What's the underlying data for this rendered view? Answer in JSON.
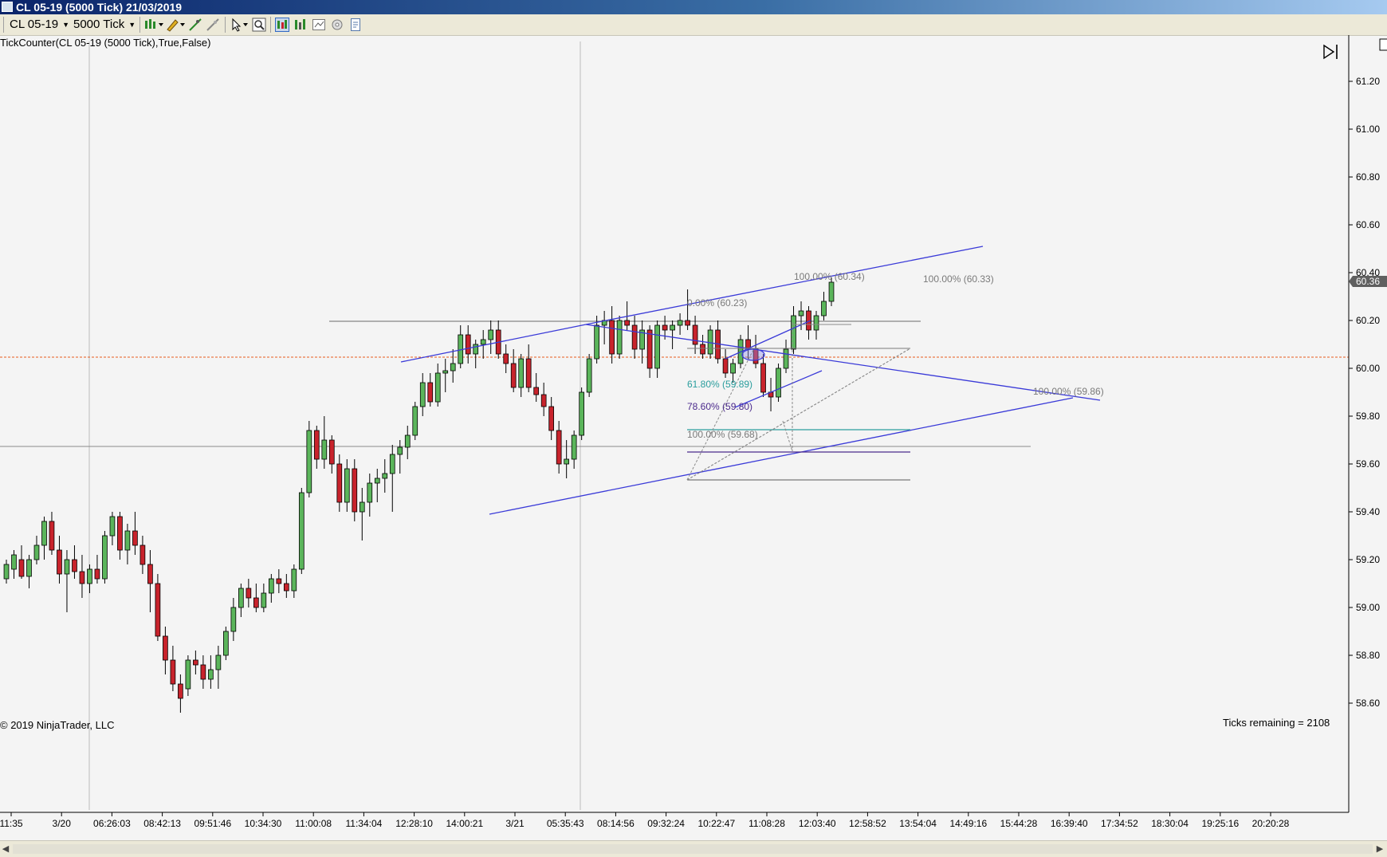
{
  "window": {
    "title": "CL 05-19 (5000 Tick)  21/03/2019"
  },
  "toolbar": {
    "instrument": "CL 05-19",
    "period": "5000 Tick"
  },
  "indicator_label": "TickCounter(CL 05-19 (5000 Tick),True,False)",
  "copyright": "© 2019 NinjaTrader, LLC",
  "ticks_remaining": "Ticks remaining = 2108",
  "price_axis": {
    "labels": [
      "61.20",
      "61.00",
      "60.80",
      "60.60",
      "60.40",
      "60.20",
      "60.00",
      "59.80",
      "59.60",
      "59.40",
      "59.20",
      "59.00",
      "58.80",
      "58.60"
    ],
    "last_price": "60.36"
  },
  "time_axis": {
    "labels": [
      "11:35",
      "3/20",
      "06:26:03",
      "08:42:13",
      "09:51:46",
      "10:34:30",
      "11:00:08",
      "11:34:04",
      "12:28:10",
      "14:00:21",
      "3/21",
      "05:35:43",
      "08:14:56",
      "09:32:24",
      "10:22:47",
      "11:08:28",
      "12:03:40",
      "12:58:52",
      "13:54:04",
      "14:49:16",
      "15:44:28",
      "16:39:40",
      "17:34:52",
      "18:30:04",
      "19:25:16",
      "20:20:28"
    ]
  },
  "fib_labels": {
    "a": "100.00% (60.34)",
    "b": "100.00% (60.33)",
    "c": "0.00% (60.23)",
    "d": "61.80% (59.89)",
    "e": "78.60% (59.80)",
    "f": "100.00% (59.68)",
    "g": "100.00% (59.86)"
  },
  "colors": {
    "up_candle": "#5bb55b",
    "down_candle": "#c8232c",
    "trendline": "#3a3ad8",
    "fib_618": "#2a9d9d",
    "fib_786": "#4b2a8c",
    "current_price_line": "#e85c1c",
    "last_price_bg": "#606060"
  },
  "chart_data": {
    "type": "candlestick",
    "instrument": "CL 05-19",
    "ylim": [
      58.55,
      61.34
    ],
    "y_ticks": [
      61.2,
      61.0,
      60.8,
      60.6,
      60.4,
      60.2,
      60.0,
      59.8,
      59.6,
      59.4,
      59.2,
      59.0,
      58.8,
      58.6
    ],
    "last_price": 60.36,
    "current_price_line": 60.19,
    "candles": [
      {
        "o": 59.12,
        "h": 59.2,
        "l": 59.1,
        "c": 59.18
      },
      {
        "o": 59.16,
        "h": 59.24,
        "l": 59.12,
        "c": 59.22
      },
      {
        "o": 59.2,
        "h": 59.26,
        "l": 59.12,
        "c": 59.13
      },
      {
        "o": 59.13,
        "h": 59.22,
        "l": 59.08,
        "c": 59.2
      },
      {
        "o": 59.2,
        "h": 59.3,
        "l": 59.18,
        "c": 59.26
      },
      {
        "o": 59.26,
        "h": 59.38,
        "l": 59.2,
        "c": 59.36
      },
      {
        "o": 59.36,
        "h": 59.4,
        "l": 59.22,
        "c": 59.24
      },
      {
        "o": 59.24,
        "h": 59.3,
        "l": 59.1,
        "c": 59.14
      },
      {
        "o": 59.14,
        "h": 59.24,
        "l": 58.98,
        "c": 59.2
      },
      {
        "o": 59.2,
        "h": 59.26,
        "l": 59.12,
        "c": 59.15
      },
      {
        "o": 59.15,
        "h": 59.22,
        "l": 59.04,
        "c": 59.1
      },
      {
        "o": 59.1,
        "h": 59.18,
        "l": 59.06,
        "c": 59.16
      },
      {
        "o": 59.16,
        "h": 59.22,
        "l": 59.1,
        "c": 59.12
      },
      {
        "o": 59.12,
        "h": 59.32,
        "l": 59.1,
        "c": 59.3
      },
      {
        "o": 59.3,
        "h": 59.4,
        "l": 59.26,
        "c": 59.38
      },
      {
        "o": 59.38,
        "h": 59.4,
        "l": 59.2,
        "c": 59.24
      },
      {
        "o": 59.24,
        "h": 59.35,
        "l": 59.18,
        "c": 59.32
      },
      {
        "o": 59.32,
        "h": 59.4,
        "l": 59.22,
        "c": 59.26
      },
      {
        "o": 59.26,
        "h": 59.3,
        "l": 59.14,
        "c": 59.18
      },
      {
        "o": 59.18,
        "h": 59.24,
        "l": 58.98,
        "c": 59.1
      },
      {
        "o": 59.1,
        "h": 59.14,
        "l": 58.86,
        "c": 58.88
      },
      {
        "o": 58.88,
        "h": 58.92,
        "l": 58.72,
        "c": 58.78
      },
      {
        "o": 58.78,
        "h": 58.84,
        "l": 58.65,
        "c": 58.68
      },
      {
        "o": 58.68,
        "h": 58.72,
        "l": 58.56,
        "c": 58.62
      },
      {
        "o": 58.66,
        "h": 58.8,
        "l": 58.63,
        "c": 58.78
      },
      {
        "o": 58.78,
        "h": 58.82,
        "l": 58.72,
        "c": 58.76
      },
      {
        "o": 58.76,
        "h": 58.8,
        "l": 58.66,
        "c": 58.7
      },
      {
        "o": 58.7,
        "h": 58.8,
        "l": 58.66,
        "c": 58.74
      },
      {
        "o": 58.74,
        "h": 58.84,
        "l": 58.66,
        "c": 58.8
      },
      {
        "o": 58.8,
        "h": 58.92,
        "l": 58.78,
        "c": 58.9
      },
      {
        "o": 58.9,
        "h": 59.04,
        "l": 58.86,
        "c": 59.0
      },
      {
        "o": 59.0,
        "h": 59.1,
        "l": 58.96,
        "c": 59.08
      },
      {
        "o": 59.08,
        "h": 59.12,
        "l": 59.0,
        "c": 59.04
      },
      {
        "o": 59.04,
        "h": 59.1,
        "l": 58.98,
        "c": 59.0
      },
      {
        "o": 59.0,
        "h": 59.1,
        "l": 58.98,
        "c": 59.06
      },
      {
        "o": 59.06,
        "h": 59.14,
        "l": 59.02,
        "c": 59.12
      },
      {
        "o": 59.12,
        "h": 59.16,
        "l": 59.06,
        "c": 59.1
      },
      {
        "o": 59.1,
        "h": 59.14,
        "l": 59.04,
        "c": 59.07
      },
      {
        "o": 59.07,
        "h": 59.18,
        "l": 59.04,
        "c": 59.16
      },
      {
        "o": 59.16,
        "h": 59.5,
        "l": 59.14,
        "c": 59.48
      },
      {
        "o": 59.48,
        "h": 59.78,
        "l": 59.46,
        "c": 59.74
      },
      {
        "o": 59.74,
        "h": 59.76,
        "l": 59.58,
        "c": 59.62
      },
      {
        "o": 59.62,
        "h": 59.8,
        "l": 59.58,
        "c": 59.7
      },
      {
        "o": 59.7,
        "h": 59.72,
        "l": 59.56,
        "c": 59.6
      },
      {
        "o": 59.6,
        "h": 59.64,
        "l": 59.4,
        "c": 59.44
      },
      {
        "o": 59.44,
        "h": 59.62,
        "l": 59.4,
        "c": 59.58
      },
      {
        "o": 59.58,
        "h": 59.62,
        "l": 59.36,
        "c": 59.4
      },
      {
        "o": 59.4,
        "h": 59.5,
        "l": 59.28,
        "c": 59.44
      },
      {
        "o": 59.44,
        "h": 59.56,
        "l": 59.38,
        "c": 59.52
      },
      {
        "o": 59.52,
        "h": 59.58,
        "l": 59.44,
        "c": 59.54
      },
      {
        "o": 59.54,
        "h": 59.62,
        "l": 59.48,
        "c": 59.56
      },
      {
        "o": 59.56,
        "h": 59.68,
        "l": 59.4,
        "c": 59.64
      },
      {
        "o": 59.64,
        "h": 59.7,
        "l": 59.56,
        "c": 59.67
      },
      {
        "o": 59.67,
        "h": 59.76,
        "l": 59.62,
        "c": 59.72
      },
      {
        "o": 59.72,
        "h": 59.86,
        "l": 59.7,
        "c": 59.84
      },
      {
        "o": 59.84,
        "h": 59.98,
        "l": 59.8,
        "c": 59.94
      },
      {
        "o": 59.94,
        "h": 59.98,
        "l": 59.84,
        "c": 59.86
      },
      {
        "o": 59.86,
        "h": 60.02,
        "l": 59.84,
        "c": 59.98
      },
      {
        "o": 59.98,
        "h": 60.04,
        "l": 59.9,
        "c": 59.99
      },
      {
        "o": 59.99,
        "h": 60.08,
        "l": 59.94,
        "c": 60.02
      },
      {
        "o": 60.02,
        "h": 60.18,
        "l": 60.0,
        "c": 60.14
      },
      {
        "o": 60.14,
        "h": 60.18,
        "l": 60.02,
        "c": 60.06
      },
      {
        "o": 60.06,
        "h": 60.12,
        "l": 60.0,
        "c": 60.1
      },
      {
        "o": 60.1,
        "h": 60.16,
        "l": 60.04,
        "c": 60.12
      },
      {
        "o": 60.12,
        "h": 60.2,
        "l": 60.06,
        "c": 60.16
      },
      {
        "o": 60.16,
        "h": 60.2,
        "l": 60.04,
        "c": 60.06
      },
      {
        "o": 60.06,
        "h": 60.1,
        "l": 59.98,
        "c": 60.02
      },
      {
        "o": 60.02,
        "h": 60.08,
        "l": 59.9,
        "c": 59.92
      },
      {
        "o": 59.92,
        "h": 60.06,
        "l": 59.88,
        "c": 60.04
      },
      {
        "o": 60.04,
        "h": 60.1,
        "l": 59.9,
        "c": 59.92
      },
      {
        "o": 59.92,
        "h": 59.98,
        "l": 59.86,
        "c": 59.89
      },
      {
        "o": 59.89,
        "h": 59.94,
        "l": 59.8,
        "c": 59.84
      },
      {
        "o": 59.84,
        "h": 59.88,
        "l": 59.7,
        "c": 59.74
      },
      {
        "o": 59.74,
        "h": 59.78,
        "l": 59.56,
        "c": 59.6
      },
      {
        "o": 59.6,
        "h": 59.7,
        "l": 59.54,
        "c": 59.62
      },
      {
        "o": 59.62,
        "h": 59.74,
        "l": 59.58,
        "c": 59.72
      },
      {
        "o": 59.72,
        "h": 59.92,
        "l": 59.7,
        "c": 59.9
      },
      {
        "o": 59.9,
        "h": 60.06,
        "l": 59.88,
        "c": 60.04
      },
      {
        "o": 60.04,
        "h": 60.22,
        "l": 60.02,
        "c": 60.18
      },
      {
        "o": 60.18,
        "h": 60.24,
        "l": 60.1,
        "c": 60.2
      },
      {
        "o": 60.2,
        "h": 60.26,
        "l": 60.02,
        "c": 60.06
      },
      {
        "o": 60.06,
        "h": 60.22,
        "l": 60.04,
        "c": 60.2
      },
      {
        "o": 60.2,
        "h": 60.28,
        "l": 60.16,
        "c": 60.18
      },
      {
        "o": 60.18,
        "h": 60.22,
        "l": 60.04,
        "c": 60.08
      },
      {
        "o": 60.08,
        "h": 60.2,
        "l": 60.02,
        "c": 60.16
      },
      {
        "o": 60.16,
        "h": 60.18,
        "l": 59.96,
        "c": 60.0
      },
      {
        "o": 60.0,
        "h": 60.2,
        "l": 59.96,
        "c": 60.18
      },
      {
        "o": 60.18,
        "h": 60.22,
        "l": 60.12,
        "c": 60.16
      },
      {
        "o": 60.16,
        "h": 60.2,
        "l": 60.08,
        "c": 60.18
      },
      {
        "o": 60.18,
        "h": 60.23,
        "l": 60.14,
        "c": 60.2
      },
      {
        "o": 60.2,
        "h": 60.33,
        "l": 60.16,
        "c": 60.18
      },
      {
        "o": 60.18,
        "h": 60.22,
        "l": 60.06,
        "c": 60.1
      },
      {
        "o": 60.1,
        "h": 60.14,
        "l": 60.04,
        "c": 60.06
      },
      {
        "o": 60.06,
        "h": 60.18,
        "l": 60.04,
        "c": 60.16
      },
      {
        "o": 60.16,
        "h": 60.2,
        "l": 60.02,
        "c": 60.04
      },
      {
        "o": 60.04,
        "h": 60.08,
        "l": 59.96,
        "c": 59.98
      },
      {
        "o": 59.98,
        "h": 60.04,
        "l": 59.94,
        "c": 60.02
      },
      {
        "o": 60.02,
        "h": 60.14,
        "l": 60.0,
        "c": 60.12
      },
      {
        "o": 60.12,
        "h": 60.18,
        "l": 60.04,
        "c": 60.08
      },
      {
        "o": 60.08,
        "h": 60.14,
        "l": 60.0,
        "c": 60.02
      },
      {
        "o": 60.02,
        "h": 60.06,
        "l": 59.88,
        "c": 59.9
      },
      {
        "o": 59.9,
        "h": 59.96,
        "l": 59.82,
        "c": 59.88
      },
      {
        "o": 59.88,
        "h": 60.02,
        "l": 59.86,
        "c": 60.0
      },
      {
        "o": 60.0,
        "h": 60.12,
        "l": 59.98,
        "c": 60.08
      },
      {
        "o": 60.08,
        "h": 60.26,
        "l": 60.06,
        "c": 60.22
      },
      {
        "o": 60.22,
        "h": 60.28,
        "l": 60.16,
        "c": 60.24
      },
      {
        "o": 60.24,
        "h": 60.26,
        "l": 60.12,
        "c": 60.16
      },
      {
        "o": 60.16,
        "h": 60.24,
        "l": 60.12,
        "c": 60.22
      },
      {
        "o": 60.22,
        "h": 60.32,
        "l": 60.2,
        "c": 60.28
      },
      {
        "o": 60.28,
        "h": 60.38,
        "l": 60.26,
        "c": 60.36
      }
    ],
    "candles_note_label": "",
    "trendlines": [
      {
        "t0": "08:42:13",
        "p0": 60.18,
        "t1": "13:54:04",
        "p1": 60.66
      },
      {
        "t0": "11:34:04",
        "p0": 60.18,
        "t1": "09:32:24",
        "p1": 60.24
      },
      {
        "t0": "3/21",
        "p0": 60.33,
        "t1": "15:44:28",
        "p1": 60.02
      },
      {
        "t0": "14:00:21",
        "p0": 59.55,
        "t1": "15:44:28",
        "p1": 60.03
      },
      {
        "t0": "09:32:24",
        "p0": 59.98,
        "t1": "11:08:28",
        "p1": 60.34
      }
    ]
  }
}
